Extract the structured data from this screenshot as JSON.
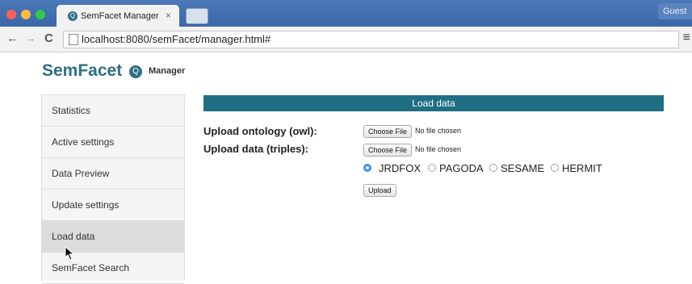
{
  "browser": {
    "tab_title": "SemFacet Manager",
    "tab_close": "×",
    "guest_label": "Guest",
    "url": "localhost:8080/semFacet/manager.html#",
    "back_glyph": "←",
    "forward_glyph": "→",
    "reload_glyph": "C",
    "menu_glyph": "≡",
    "traffic_colors": [
      "#fc605c",
      "#fdbc40",
      "#34c84a"
    ]
  },
  "app": {
    "logo_text": "SemFacet",
    "logo_icon": "search-icon",
    "logo_subtitle": "Manager",
    "accent_color": "#1f6f84"
  },
  "sidebar": {
    "items": [
      {
        "label": "Statistics"
      },
      {
        "label": "Active settings"
      },
      {
        "label": "Data Preview"
      },
      {
        "label": "Update settings"
      },
      {
        "label": "Load data",
        "active": true
      },
      {
        "label": "SemFacet Search"
      }
    ]
  },
  "main": {
    "header": "Load data",
    "ontology_label": "Upload ontology (owl):",
    "data_label": "Upload data (triples):",
    "choose_file_label": "Choose File",
    "no_file_text": "No file chosen",
    "engines": [
      {
        "label": "JRDFOX",
        "selected": true
      },
      {
        "label": "PAGODA",
        "selected": false
      },
      {
        "label": "SESAME",
        "selected": false
      },
      {
        "label": "HERMIT",
        "selected": false
      }
    ],
    "upload_label": "Upload"
  }
}
